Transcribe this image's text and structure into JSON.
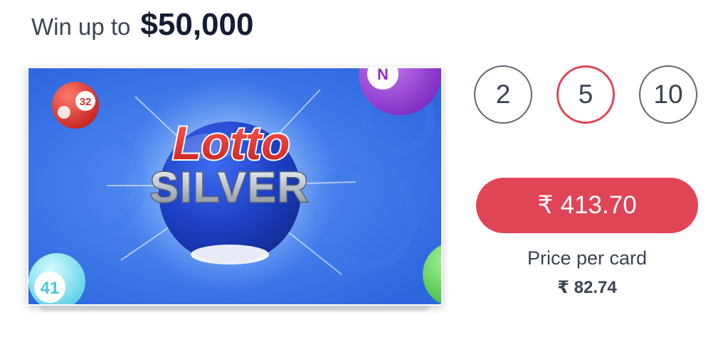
{
  "header": {
    "win_label": "Win up to",
    "win_amount": "$50,000"
  },
  "card": {
    "title_line1": "Lotto",
    "title_line2": "SILVER",
    "ball_numbers": [
      "32",
      "41",
      "N"
    ],
    "colors": {
      "background": "#2f6fe6",
      "title_red": "#e23a3a",
      "ball_red": "#e0433b",
      "ball_purple": "#9b3fd6",
      "ball_cyan": "#7de2f0",
      "ball_green": "#5fd35c"
    }
  },
  "quantity": {
    "options": [
      "2",
      "5",
      "10"
    ],
    "selected": "5"
  },
  "price": {
    "currency": "₹",
    "total": "413.70",
    "per_card_label": "Price per card",
    "per_card_value": "₹ 82.74"
  },
  "colors": {
    "accent": "#e04457",
    "headline": "#141d33",
    "text": "#3a4351"
  }
}
